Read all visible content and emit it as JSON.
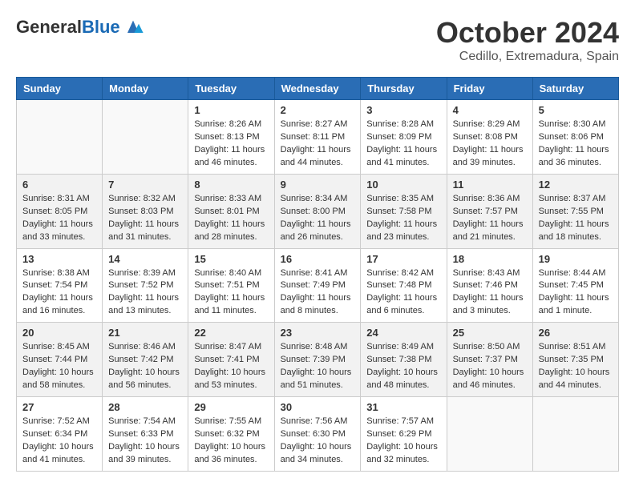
{
  "header": {
    "logo_general": "General",
    "logo_blue": "Blue",
    "month": "October 2024",
    "location": "Cedillo, Extremadura, Spain"
  },
  "weekdays": [
    "Sunday",
    "Monday",
    "Tuesday",
    "Wednesday",
    "Thursday",
    "Friday",
    "Saturday"
  ],
  "weeks": [
    [
      {
        "day": "",
        "info": ""
      },
      {
        "day": "",
        "info": ""
      },
      {
        "day": "1",
        "info": "Sunrise: 8:26 AM\nSunset: 8:13 PM\nDaylight: 11 hours and 46 minutes."
      },
      {
        "day": "2",
        "info": "Sunrise: 8:27 AM\nSunset: 8:11 PM\nDaylight: 11 hours and 44 minutes."
      },
      {
        "day": "3",
        "info": "Sunrise: 8:28 AM\nSunset: 8:09 PM\nDaylight: 11 hours and 41 minutes."
      },
      {
        "day": "4",
        "info": "Sunrise: 8:29 AM\nSunset: 8:08 PM\nDaylight: 11 hours and 39 minutes."
      },
      {
        "day": "5",
        "info": "Sunrise: 8:30 AM\nSunset: 8:06 PM\nDaylight: 11 hours and 36 minutes."
      }
    ],
    [
      {
        "day": "6",
        "info": "Sunrise: 8:31 AM\nSunset: 8:05 PM\nDaylight: 11 hours and 33 minutes."
      },
      {
        "day": "7",
        "info": "Sunrise: 8:32 AM\nSunset: 8:03 PM\nDaylight: 11 hours and 31 minutes."
      },
      {
        "day": "8",
        "info": "Sunrise: 8:33 AM\nSunset: 8:01 PM\nDaylight: 11 hours and 28 minutes."
      },
      {
        "day": "9",
        "info": "Sunrise: 8:34 AM\nSunset: 8:00 PM\nDaylight: 11 hours and 26 minutes."
      },
      {
        "day": "10",
        "info": "Sunrise: 8:35 AM\nSunset: 7:58 PM\nDaylight: 11 hours and 23 minutes."
      },
      {
        "day": "11",
        "info": "Sunrise: 8:36 AM\nSunset: 7:57 PM\nDaylight: 11 hours and 21 minutes."
      },
      {
        "day": "12",
        "info": "Sunrise: 8:37 AM\nSunset: 7:55 PM\nDaylight: 11 hours and 18 minutes."
      }
    ],
    [
      {
        "day": "13",
        "info": "Sunrise: 8:38 AM\nSunset: 7:54 PM\nDaylight: 11 hours and 16 minutes."
      },
      {
        "day": "14",
        "info": "Sunrise: 8:39 AM\nSunset: 7:52 PM\nDaylight: 11 hours and 13 minutes."
      },
      {
        "day": "15",
        "info": "Sunrise: 8:40 AM\nSunset: 7:51 PM\nDaylight: 11 hours and 11 minutes."
      },
      {
        "day": "16",
        "info": "Sunrise: 8:41 AM\nSunset: 7:49 PM\nDaylight: 11 hours and 8 minutes."
      },
      {
        "day": "17",
        "info": "Sunrise: 8:42 AM\nSunset: 7:48 PM\nDaylight: 11 hours and 6 minutes."
      },
      {
        "day": "18",
        "info": "Sunrise: 8:43 AM\nSunset: 7:46 PM\nDaylight: 11 hours and 3 minutes."
      },
      {
        "day": "19",
        "info": "Sunrise: 8:44 AM\nSunset: 7:45 PM\nDaylight: 11 hours and 1 minute."
      }
    ],
    [
      {
        "day": "20",
        "info": "Sunrise: 8:45 AM\nSunset: 7:44 PM\nDaylight: 10 hours and 58 minutes."
      },
      {
        "day": "21",
        "info": "Sunrise: 8:46 AM\nSunset: 7:42 PM\nDaylight: 10 hours and 56 minutes."
      },
      {
        "day": "22",
        "info": "Sunrise: 8:47 AM\nSunset: 7:41 PM\nDaylight: 10 hours and 53 minutes."
      },
      {
        "day": "23",
        "info": "Sunrise: 8:48 AM\nSunset: 7:39 PM\nDaylight: 10 hours and 51 minutes."
      },
      {
        "day": "24",
        "info": "Sunrise: 8:49 AM\nSunset: 7:38 PM\nDaylight: 10 hours and 48 minutes."
      },
      {
        "day": "25",
        "info": "Sunrise: 8:50 AM\nSunset: 7:37 PM\nDaylight: 10 hours and 46 minutes."
      },
      {
        "day": "26",
        "info": "Sunrise: 8:51 AM\nSunset: 7:35 PM\nDaylight: 10 hours and 44 minutes."
      }
    ],
    [
      {
        "day": "27",
        "info": "Sunrise: 7:52 AM\nSunset: 6:34 PM\nDaylight: 10 hours and 41 minutes."
      },
      {
        "day": "28",
        "info": "Sunrise: 7:54 AM\nSunset: 6:33 PM\nDaylight: 10 hours and 39 minutes."
      },
      {
        "day": "29",
        "info": "Sunrise: 7:55 AM\nSunset: 6:32 PM\nDaylight: 10 hours and 36 minutes."
      },
      {
        "day": "30",
        "info": "Sunrise: 7:56 AM\nSunset: 6:30 PM\nDaylight: 10 hours and 34 minutes."
      },
      {
        "day": "31",
        "info": "Sunrise: 7:57 AM\nSunset: 6:29 PM\nDaylight: 10 hours and 32 minutes."
      },
      {
        "day": "",
        "info": ""
      },
      {
        "day": "",
        "info": ""
      }
    ]
  ]
}
